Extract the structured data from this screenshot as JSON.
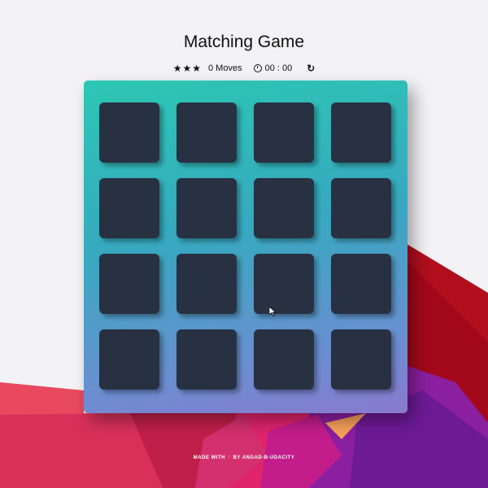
{
  "header": {
    "title": "Matching Game"
  },
  "score_panel": {
    "stars": "★★★",
    "star_count": 3,
    "moves_label": "0 Moves",
    "timer": "00 : 00",
    "restart_icon": "restart-icon"
  },
  "deck": {
    "rows": 4,
    "columns": 4,
    "card_state": "face-down",
    "card_color": "#283142"
  },
  "footer": {
    "text_before": "MADE WITH",
    "heart": "♥",
    "text_after": "BY ANGAD-B-UDACITY"
  },
  "colors": {
    "deck_top": "#2cc7b3",
    "deck_bottom": "#8a79cf",
    "background_accent_red": "#c8102e",
    "background_accent_purple": "#7a1ea1"
  }
}
